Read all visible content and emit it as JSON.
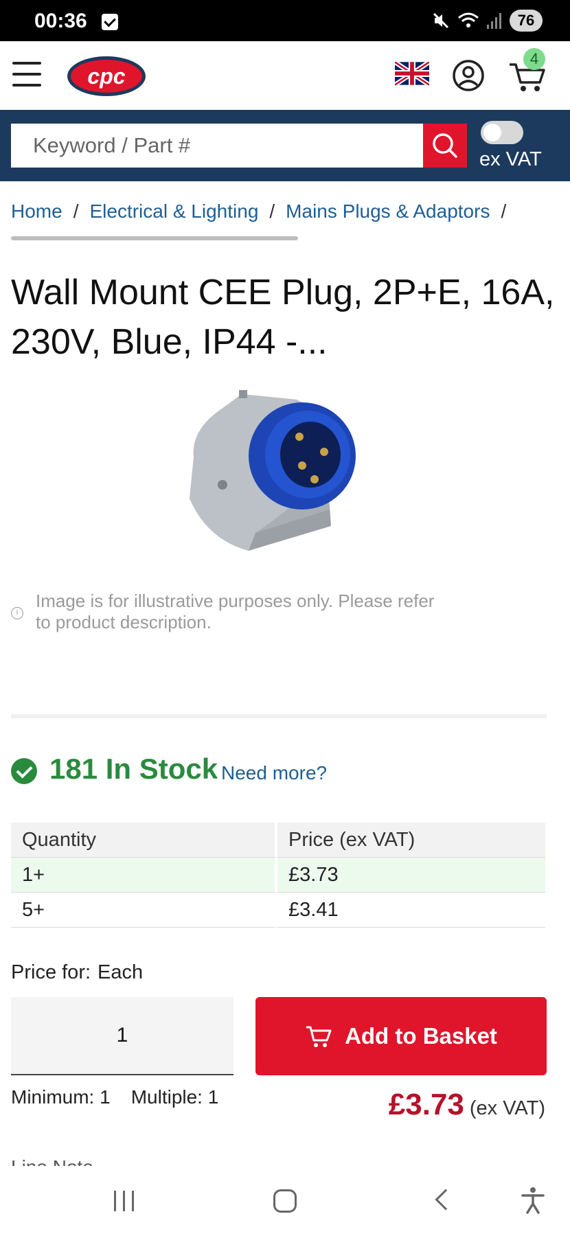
{
  "status": {
    "time": "00:36",
    "battery": "76"
  },
  "header": {
    "logo_text": "cpc",
    "cart_count": "4"
  },
  "search": {
    "placeholder": "Keyword / Part #",
    "vat_label": "ex VAT"
  },
  "breadcrumb": {
    "items": [
      "Home",
      "Electrical & Lighting",
      "Mains Plugs & Adaptors"
    ],
    "separator": "/"
  },
  "product": {
    "title": "Wall Mount CEE Plug, 2P+E, 16A, 230V, Blue, IP44 -...",
    "image_note": "Image is for illustrative purposes only. Please refer to product description."
  },
  "stock": {
    "text": "181 In Stock",
    "need_more": "Need more?"
  },
  "price_table": {
    "headers": [
      "Quantity",
      "Price (ex VAT)"
    ],
    "rows": [
      {
        "qty": "1+",
        "price": "£3.73"
      },
      {
        "qty": "5+",
        "price": "£3.41"
      }
    ]
  },
  "purchase": {
    "price_for_label": "Price for:",
    "price_for_value": "Each",
    "quantity": "1",
    "add_button": "Add to Basket",
    "minimum": "Minimum: 1",
    "multiple": "Multiple: 1",
    "price": "£3.73",
    "price_vat": "(ex VAT)",
    "line_note": "Line Note"
  },
  "colors": {
    "brand_red": "#e0152c",
    "navy": "#1c3a5e",
    "stock_green": "#2a8a3e",
    "link_blue": "#1f5e93",
    "price_red": "#b5122a"
  },
  "icons": [
    "menu-icon",
    "uk-flag-icon",
    "account-icon",
    "cart-icon",
    "search-icon",
    "info-icon",
    "check-circle-icon",
    "basket-icon"
  ]
}
